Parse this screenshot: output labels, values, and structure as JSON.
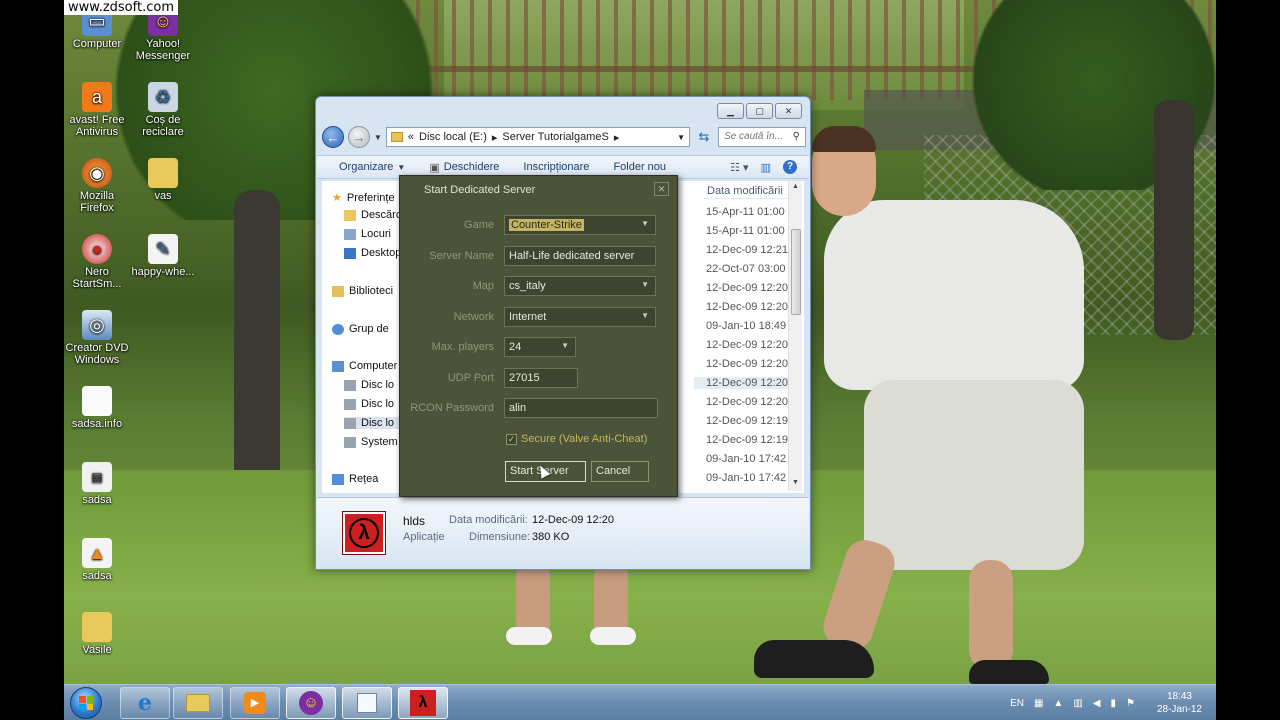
{
  "watermark": "www.zdsoft.com",
  "desktop": {
    "icons": [
      {
        "label": "Computer",
        "icon": "computer-icon"
      },
      {
        "label": "Yahoo!\nMessenger",
        "icon": "yahoo-messenger-icon"
      },
      {
        "label": "avast! Free\nAntivirus",
        "icon": "avast-icon"
      },
      {
        "label": "Coș de\nreciclare",
        "icon": "recycle-bin-icon"
      },
      {
        "label": "Mozilla\nFirefox",
        "icon": "firefox-icon"
      },
      {
        "label": "vas",
        "icon": "folder-icon"
      },
      {
        "label": "Nero\nStartSm...",
        "icon": "nero-icon"
      },
      {
        "label": "happy-whe...",
        "icon": "document-icon"
      },
      {
        "label": "Creator DVD\nWindows",
        "icon": "dvd-maker-icon"
      },
      {
        "label": "sadsa.info",
        "icon": "text-file-icon"
      },
      {
        "label": "sadsa",
        "icon": "app-icon"
      },
      {
        "label": "sadsa",
        "icon": "vlc-icon"
      },
      {
        "label": "Vasile",
        "icon": "folder-icon"
      }
    ]
  },
  "explorer": {
    "address": {
      "prefix": "«",
      "crumbs": [
        "Disc local (E:)",
        "Server TutorialgameS"
      ]
    },
    "search_placeholder": "Se caută în...",
    "toolbar": {
      "organize": "Organizare",
      "open": "Deschidere",
      "burn": "Inscripționare",
      "new_folder": "Folder nou"
    },
    "nav": [
      {
        "label": "Preferințe",
        "icon": "star-icon"
      },
      {
        "label": "Descărcări",
        "icon": "downloads-icon"
      },
      {
        "label": "Locuri",
        "icon": "recent-places-icon"
      },
      {
        "label": "Desktop",
        "icon": "desktop-icon"
      },
      {
        "label": "Biblioteci",
        "icon": "libraries-icon"
      },
      {
        "label": "Grup de",
        "icon": "homegroup-icon"
      },
      {
        "label": "Computer",
        "icon": "computer-icon"
      },
      {
        "label": "Disc lo",
        "icon": "drive-icon"
      },
      {
        "label": "Disc lo",
        "icon": "drive-icon"
      },
      {
        "label": "Disc lo",
        "icon": "drive-icon"
      },
      {
        "label": "System",
        "icon": "drive-icon"
      },
      {
        "label": "Rețea",
        "icon": "network-icon"
      }
    ],
    "column_header": "Data modificării",
    "dates": [
      "15-Apr-11 01:00",
      "15-Apr-11 01:00",
      "12-Dec-09 12:21",
      "22-Oct-07 03:00",
      "12-Dec-09 12:20",
      "12-Dec-09 12:20",
      "09-Jan-10 18:49",
      "12-Dec-09 12:20",
      "12-Dec-09 12:20",
      "12-Dec-09 12:20",
      "12-Dec-09 12:20",
      "12-Dec-09 12:19",
      "12-Dec-09 12:19",
      "09-Jan-10 17:42",
      "09-Jan-10 17:42"
    ],
    "details": {
      "name": "hlds",
      "type": "Aplicație",
      "modified_label": "Data modificării:",
      "modified_value": "12-Dec-09 12:20",
      "size_label": "Dimensiune:",
      "size_value": "380 KO"
    }
  },
  "dialog": {
    "title": "Start Dedicated Server",
    "fields": {
      "game": {
        "label": "Game",
        "value": "Counter-Strike"
      },
      "server_name": {
        "label": "Server Name",
        "value": "Half-Life dedicated server"
      },
      "map": {
        "label": "Map",
        "value": "cs_italy"
      },
      "network": {
        "label": "Network",
        "value": "Internet"
      },
      "max_players": {
        "label": "Max. players",
        "value": "24"
      },
      "udp_port": {
        "label": "UDP Port",
        "value": "27015"
      },
      "rcon_password": {
        "label": "RCON Password",
        "value": "alin"
      }
    },
    "secure_label": "Secure (Valve Anti-Cheat)",
    "secure_checked": true,
    "start_button": "Start Server",
    "cancel_button": "Cancel"
  },
  "taskbar": {
    "apps": [
      "internet-explorer-icon",
      "explorer-folder-icon",
      "media-player-icon",
      "yahoo-messenger-icon",
      "window-app-icon",
      "half-life-icon"
    ],
    "language": "EN",
    "time": "18:43",
    "date": "28-Jan-12"
  },
  "colors": {
    "dialog_bg": "#4b5338",
    "dialog_accent": "#c4b565",
    "explorer_bg": "#d7e4f2"
  }
}
